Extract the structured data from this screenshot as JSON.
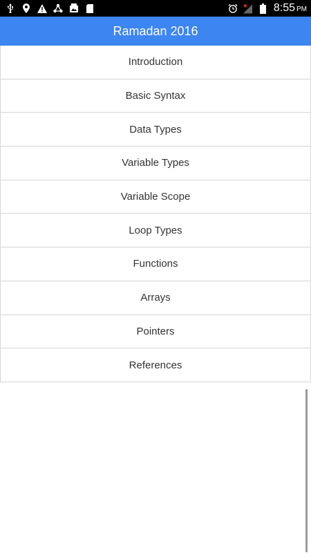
{
  "status_bar": {
    "left_icons": [
      "usb-icon",
      "location-icon",
      "warning-icon",
      "share-icon",
      "photo-icon",
      "sd-card-icon"
    ],
    "right_icons": [
      "alarm-icon",
      "no-signal-icon",
      "battery-icon"
    ],
    "time": "8:55",
    "ampm": "PM"
  },
  "app_bar": {
    "title": "Ramadan 2016",
    "color": "#3d85f0"
  },
  "menu": {
    "items": [
      {
        "label": "Introduction"
      },
      {
        "label": "Basic Syntax"
      },
      {
        "label": "Data Types"
      },
      {
        "label": "Variable Types"
      },
      {
        "label": "Variable Scope"
      },
      {
        "label": "Loop Types"
      },
      {
        "label": "Functions"
      },
      {
        "label": "Arrays"
      },
      {
        "label": "Pointers"
      },
      {
        "label": "References"
      }
    ]
  }
}
